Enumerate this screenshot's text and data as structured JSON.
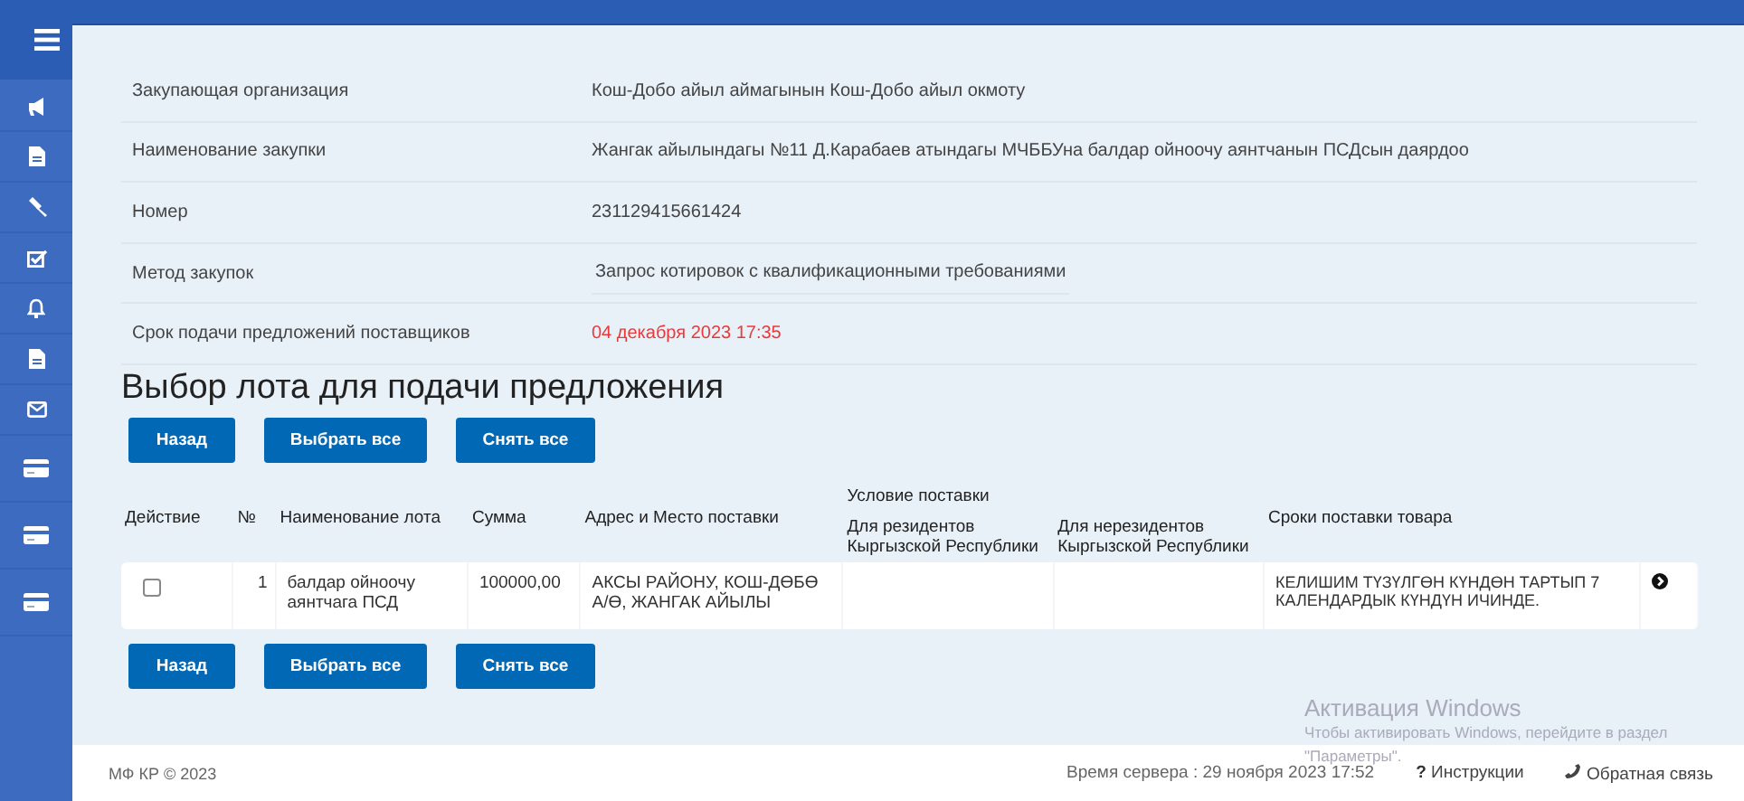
{
  "sidebar": {
    "items": [
      {
        "kind": "megaphone"
      },
      {
        "kind": "document"
      },
      {
        "kind": "gavel"
      },
      {
        "kind": "checkbox"
      },
      {
        "kind": "bell"
      },
      {
        "kind": "document"
      },
      {
        "kind": "mail"
      },
      {
        "kind": "card"
      },
      {
        "kind": "card"
      },
      {
        "kind": "card"
      }
    ]
  },
  "info": [
    {
      "label": "Закупающая организация",
      "value": "Кош-Добо айыл аймагынын Кош-Добо айыл окмоту",
      "kind": "plain"
    },
    {
      "label": "Наименование закупки",
      "value": "Жангак айылындагы №11 Д.Карабаев атындагы МЧББУна балдар ойноочу аянтчанын ПСДсын даярдоо",
      "kind": "plain"
    },
    {
      "label": "Номер",
      "value": "231129415661424",
      "kind": "plain"
    },
    {
      "label": "Метод закупок",
      "value": "Запрос котировок с квалификационными требованиями",
      "kind": "underlined"
    },
    {
      "label": "Срок подачи предложений поставщиков",
      "value": "04 декабря 2023 17:35",
      "kind": "deadline"
    }
  ],
  "heading": "Выбор лота для подачи предложения",
  "buttons_top": [
    "Назад",
    "Выбрать все",
    "Снять все"
  ],
  "table": {
    "columns": {
      "action": "Действие",
      "number": "№",
      "name": "Наименование лота",
      "sum": "Сумма",
      "address": "Адрес и Место поставки",
      "condition": "Условие поставки",
      "residents": "Для резидентов Кыргызской Республики",
      "nonresidents": "Для нерезидентов Кыргызской Республики",
      "terms": "Сроки поставки товара"
    },
    "rows": [
      {
        "checked": false,
        "number": "1",
        "name": "балдар ойноочу аянтчага ПСД",
        "sum": "100000,00",
        "address": "АКСЫ РАЙОНУ, КОШ-ДӨБӨ А/Ө, ЖАНГАК АЙЫЛЫ",
        "terms": "КЕЛИШИМ ТҮЗҮЛГӨН КҮНДӨН ТАРТЫП 7 КАЛЕНДАРДЫК КҮНДҮН ИЧИНДЕ."
      }
    ]
  },
  "buttons_bottom": [
    "Назад",
    "Выбрать все",
    "Снять все"
  ],
  "activation": {
    "title": "Активация Windows",
    "text": "Чтобы активировать Windows, перейдите в раздел \"Параметры\"."
  },
  "footer": {
    "copyright": "МФ КР © 2023",
    "server_time": "Время сервера : 29 ноября 2023 17:52",
    "help": "Инструкции",
    "help_mark": "?",
    "feedback": "Обратная связь"
  }
}
